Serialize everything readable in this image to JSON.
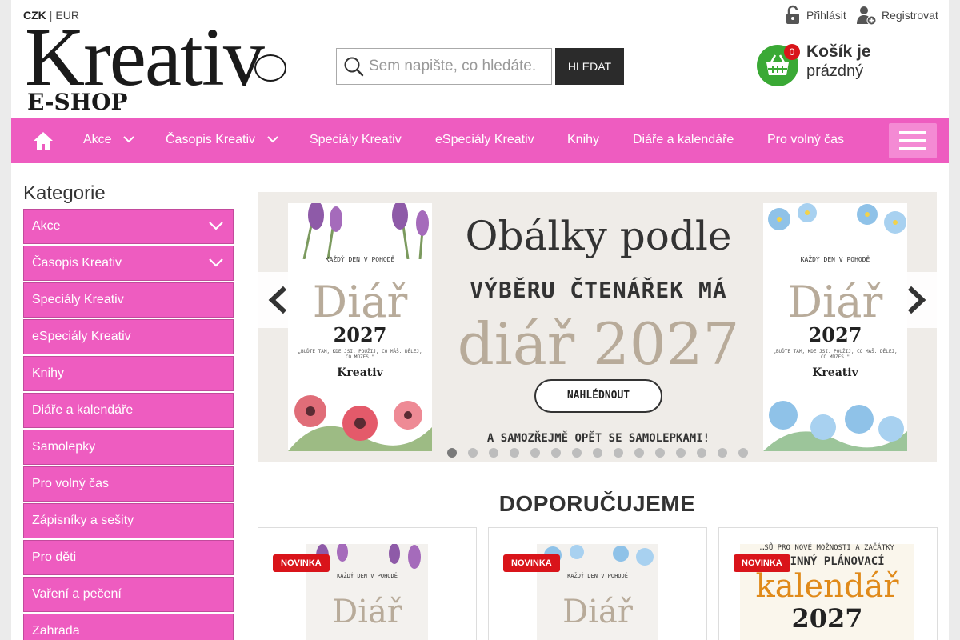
{
  "currency": {
    "active": "CZK",
    "separator": "|",
    "other": "EUR"
  },
  "logo": {
    "brand": "Kreativ",
    "sub": "E-SHOP"
  },
  "search": {
    "placeholder": "Sem napište, co hledáte.",
    "button": "HLEDAT"
  },
  "account": {
    "login": "Přihlásit",
    "register": "Registrovat"
  },
  "cart": {
    "count": "0",
    "line1": "Košík je",
    "line2": "prázdný"
  },
  "nav": {
    "items": [
      {
        "label": "Akce",
        "dropdown": true
      },
      {
        "label": "Časopis Kreativ",
        "dropdown": true
      },
      {
        "label": "Speciály Kreativ"
      },
      {
        "label": "eSpeciály Kreativ"
      },
      {
        "label": "Knihy"
      },
      {
        "label": "Diáře a kalendáře"
      },
      {
        "label": "Pro volný čas"
      }
    ]
  },
  "sidebar": {
    "title": "Kategorie",
    "items": [
      {
        "label": "Akce",
        "dropdown": true
      },
      {
        "label": "Časopis Kreativ",
        "dropdown": true
      },
      {
        "label": "Speciály Kreativ"
      },
      {
        "label": "eSpeciály Kreativ"
      },
      {
        "label": "Knihy"
      },
      {
        "label": "Diáře a kalendáře"
      },
      {
        "label": "Samolepky"
      },
      {
        "label": "Pro volný čas"
      },
      {
        "label": "Zápisníky a sešity"
      },
      {
        "label": "Pro děti"
      },
      {
        "label": "Vaření a pečení"
      },
      {
        "label": "Zahrada"
      }
    ]
  },
  "slider": {
    "headline": "Obálky podle",
    "subline": "VÝBĚRU ČTENÁŘEK MÁ",
    "product": "diář 2027",
    "button": "NAHLÉDNOUT",
    "footer": "A SAMOZŘEJMĚ OPĚT SE SAMOLEPKAMI!",
    "cover": {
      "small": "KAŽDÝ DEN V POHODĚ",
      "title": "Diář",
      "year": "2027",
      "quote": "„BUĎTE TAM, KDE JSI. POUŽIJ, CO MÁŠ. DĚLEJ, CO MŮŽEŠ.\"",
      "brand": "Kreativ"
    },
    "dot_count": 15,
    "active_dot": 1
  },
  "recommended": {
    "title": "DOPORUČUJEME",
    "products": [
      {
        "badge": "NOVINKA",
        "small": "KAŽDÝ DEN V POHODĚ",
        "title": "Diář"
      },
      {
        "badge": "NOVINKA",
        "small": "KAŽDÝ DEN V POHODĚ",
        "title": "Diář"
      },
      {
        "badge": "NOVINKA",
        "top": "…SŮ PRO NOVÉ MOŽNOSTI A ZAČÁTKY",
        "sub": "RODINNÝ PLÁNOVACÍ",
        "title": "kalendář",
        "year": "2027"
      }
    ]
  },
  "colors": {
    "nav": "#ee5cc0",
    "cart": "#3aa935",
    "badge": "#d9141a",
    "button": "#2b2b2b"
  }
}
